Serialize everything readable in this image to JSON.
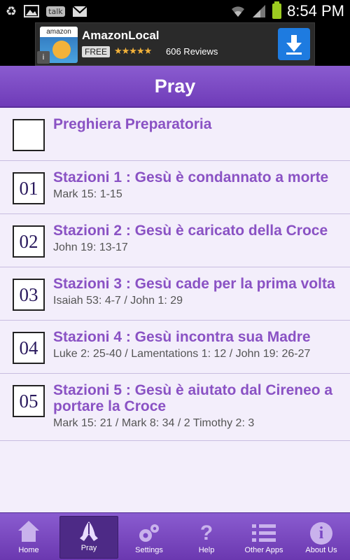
{
  "status_bar": {
    "icons": [
      "recycle-icon",
      "image-icon",
      "talk-icon",
      "gmail-icon",
      "wifi-icon",
      "signal-icon",
      "battery-icon"
    ],
    "talk_label": "talk",
    "time": "8:54 PM"
  },
  "ad": {
    "logo_text": "amazon",
    "title": "AmazonLocal",
    "badge": "FREE",
    "stars": "★★★★★",
    "rating": 4.5,
    "reviews": "606 Reviews",
    "info_glyph": "i"
  },
  "header": {
    "title": "Pray"
  },
  "list": {
    "items": [
      {
        "number": "",
        "title": "Preghiera Preparatoria",
        "ref": ""
      },
      {
        "number": "01",
        "title": "Stazioni 1 : Gesù è condannato a morte",
        "ref": "Mark 15: 1-15"
      },
      {
        "number": "02",
        "title": "Stazioni 2 : Gesù è caricato della Croce",
        "ref": "John 19: 13-17"
      },
      {
        "number": "03",
        "title": "Stazioni 3 : Gesù cade per la prima volta",
        "ref": "Isaiah 53: 4-7 / John 1: 29"
      },
      {
        "number": "04",
        "title": "Stazioni 4 : Gesù incontra sua Madre",
        "ref": "Luke 2: 25-40 / Lamentations 1: 12 / John 19: 26-27"
      },
      {
        "number": "05",
        "title": "Stazioni 5 : Gesù è aiutato dal Cireneo a portare la Croce",
        "ref": "Mark 15: 21 / Mark 8: 34 / 2 Timothy 2: 3"
      }
    ]
  },
  "tabs": [
    {
      "label": "Home",
      "icon": "home-icon"
    },
    {
      "label": "Pray",
      "icon": "praying-hands-icon",
      "active": true
    },
    {
      "label": "Settings",
      "icon": "gears-icon"
    },
    {
      "label": "Help",
      "icon": "question-icon"
    },
    {
      "label": "Other Apps",
      "icon": "list-icon"
    },
    {
      "label": "About Us",
      "icon": "info-icon"
    }
  ],
  "colors": {
    "accent": "#8a52c4",
    "header": "#7a48c4",
    "list_bg": "#f3eefb",
    "battery": "#9ccc20"
  }
}
